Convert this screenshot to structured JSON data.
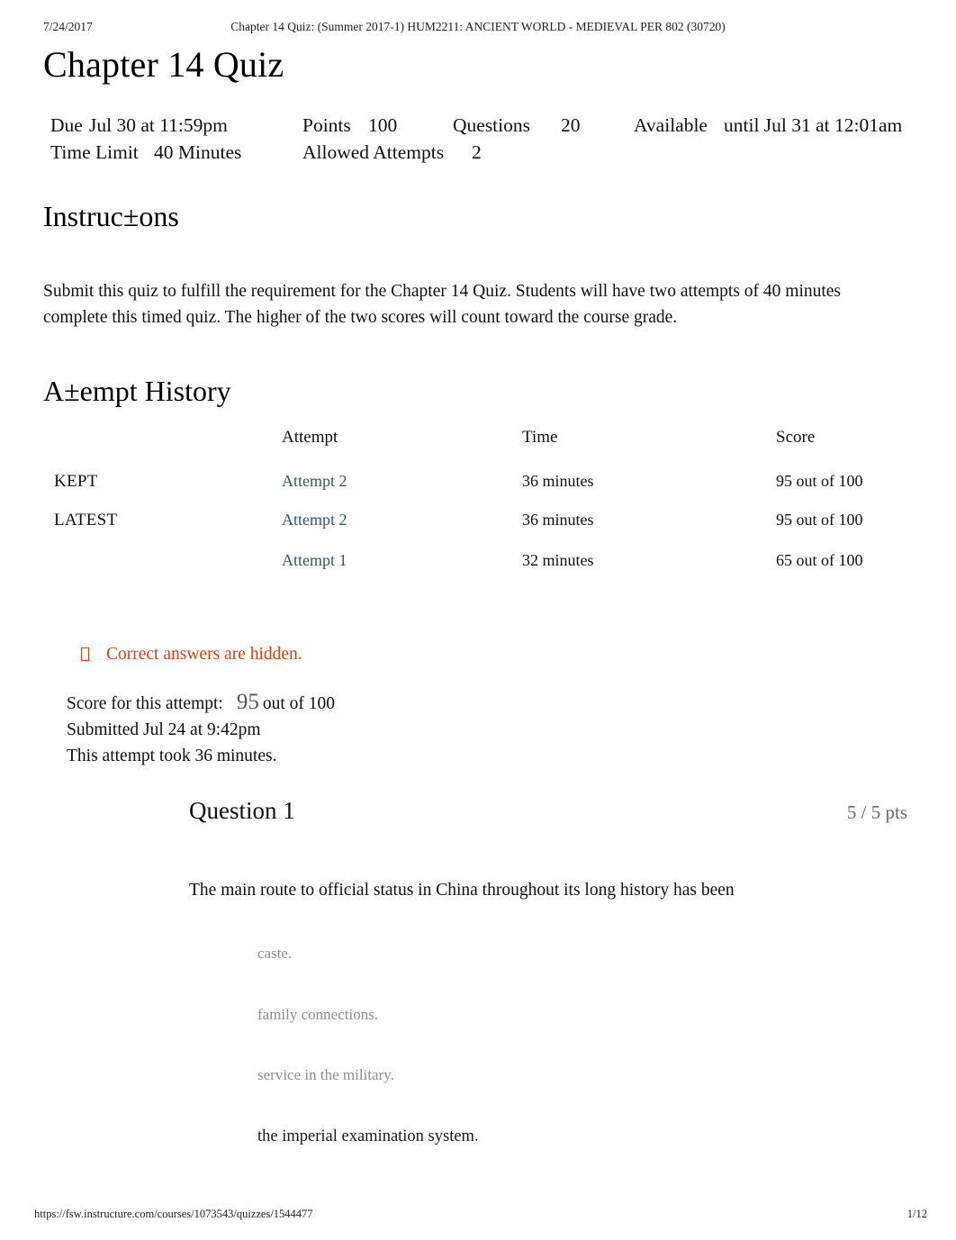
{
  "print_header": {
    "date": "7/24/2017",
    "title": "Chapter 14 Quiz: (Summer 2017-1) HUM2211: ANCIENT WORLD - MEDIEVAL PER 802 (30720)"
  },
  "print_footer": {
    "url": "https://fsw.instructure.com/courses/1073543/quizzes/1544477",
    "page": "1/12"
  },
  "quiz": {
    "title": "Chapter 14 Quiz",
    "details": {
      "due_label": "Due",
      "due_value": "Jul 30 at 11:59pm",
      "points_label": "Points",
      "points_value": "100",
      "questions_label": "Questions",
      "questions_value": "20",
      "available_label": "Available",
      "available_value": "until Jul 31 at 12:01am",
      "time_limit_label": "Time Limit",
      "time_limit_value": "40 Minutes",
      "allowed_attempts_label": "Allowed Attempts",
      "allowed_attempts_value": "2"
    }
  },
  "instructions": {
    "heading": "Instruc±ons",
    "body": "Submit this quiz to fulfill the requirement for the Chapter 14 Quiz. Students will have two attempts of 40 minutes complete this timed quiz. The higher of the two scores will count toward the course grade."
  },
  "attempt_history": {
    "heading": "A±empt History",
    "columns": {
      "kind": "",
      "attempt": "Attempt",
      "time": "Time",
      "score": "Score"
    },
    "rows": [
      {
        "kind": "KEPT",
        "attempt": "Attempt 2",
        "time": "36 minutes",
        "score": "95 out of 100"
      },
      {
        "kind": "LATEST",
        "attempt": "Attempt 2",
        "time": "36 minutes",
        "score": "95 out of 100"
      },
      {
        "kind": "",
        "attempt": "Attempt 1",
        "time": "32 minutes",
        "score": "65 out of 100"
      }
    ]
  },
  "hidden_notice": {
    "text": "Correct answers are hidden.",
    "icon": "missing-glyph-box-icon",
    "color": "#cf4512"
  },
  "attempt_summary": {
    "score_label": "Score for this attempt:",
    "score_value": "95",
    "score_suffix": "out of 100",
    "submitted": "Submitted Jul 24 at 9:42pm",
    "duration": "This attempt took 36 minutes."
  },
  "question": {
    "number": "Question 1",
    "points": "5 / 5 pts",
    "text": "The main route to official status in China throughout its long history has been",
    "answers": [
      {
        "label": "caste.",
        "selected": false
      },
      {
        "label": "family connections.",
        "selected": false
      },
      {
        "label": "service in the military.",
        "selected": false
      },
      {
        "label": "the imperial examination system.",
        "selected": true
      }
    ]
  },
  "colors": {
    "link": "#2e5c63",
    "notice": "#cf4512",
    "muted": "#8d8d8d",
    "points": "#696969"
  }
}
